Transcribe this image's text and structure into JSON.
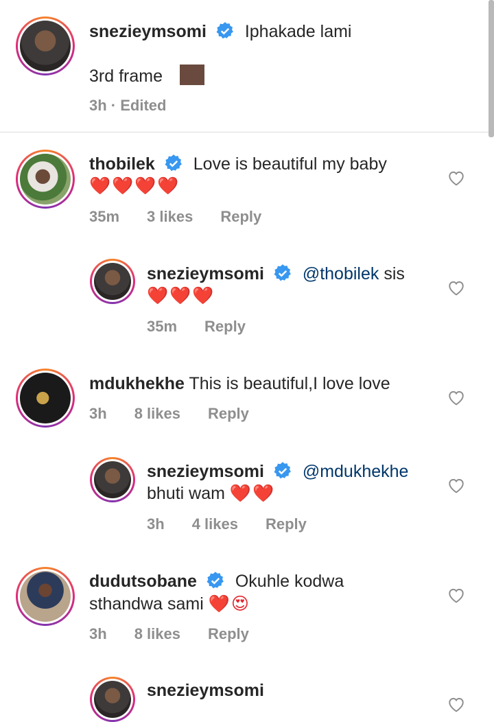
{
  "caption": {
    "username": "snezieymsomi",
    "text_line1": "Iphakade lami",
    "text_line2": "3rd frame",
    "time": "3h · Edited"
  },
  "comments": [
    {
      "username": "thobilek",
      "text": "Love is beautiful my baby",
      "emoji": "❤️❤️❤️❤️",
      "time": "35m",
      "likes": "3 likes",
      "reply": "Reply"
    },
    {
      "username": "snezieymsomi",
      "mention": "@thobilek",
      "text": "sis",
      "emoji": "❤️❤️❤️",
      "time": "35m",
      "reply": "Reply"
    },
    {
      "username": "mdukhekhe",
      "text": "This is beautiful,I love love",
      "time": "3h",
      "likes": "8 likes",
      "reply": "Reply"
    },
    {
      "username": "snezieymsomi",
      "mention": "@mdukhekhe",
      "text": "bhuti wam",
      "emoji": "❤️❤️",
      "time": "3h",
      "likes": "4 likes",
      "reply": "Reply"
    },
    {
      "username": "dudutsobane",
      "text_line1": "Okuhle kodwa",
      "text_line2": "sthandwa sami",
      "emoji": "❤️😍",
      "time": "3h",
      "likes": "8 likes",
      "reply": "Reply"
    },
    {
      "username": "snezieymsomi"
    }
  ],
  "icons": {
    "verified": "verified-badge-icon",
    "like": "heart-outline-icon"
  },
  "colors": {
    "verified": "#3897f0",
    "mention": "#00376b",
    "meta": "#8e8e8e",
    "heart": "#e3262e"
  }
}
